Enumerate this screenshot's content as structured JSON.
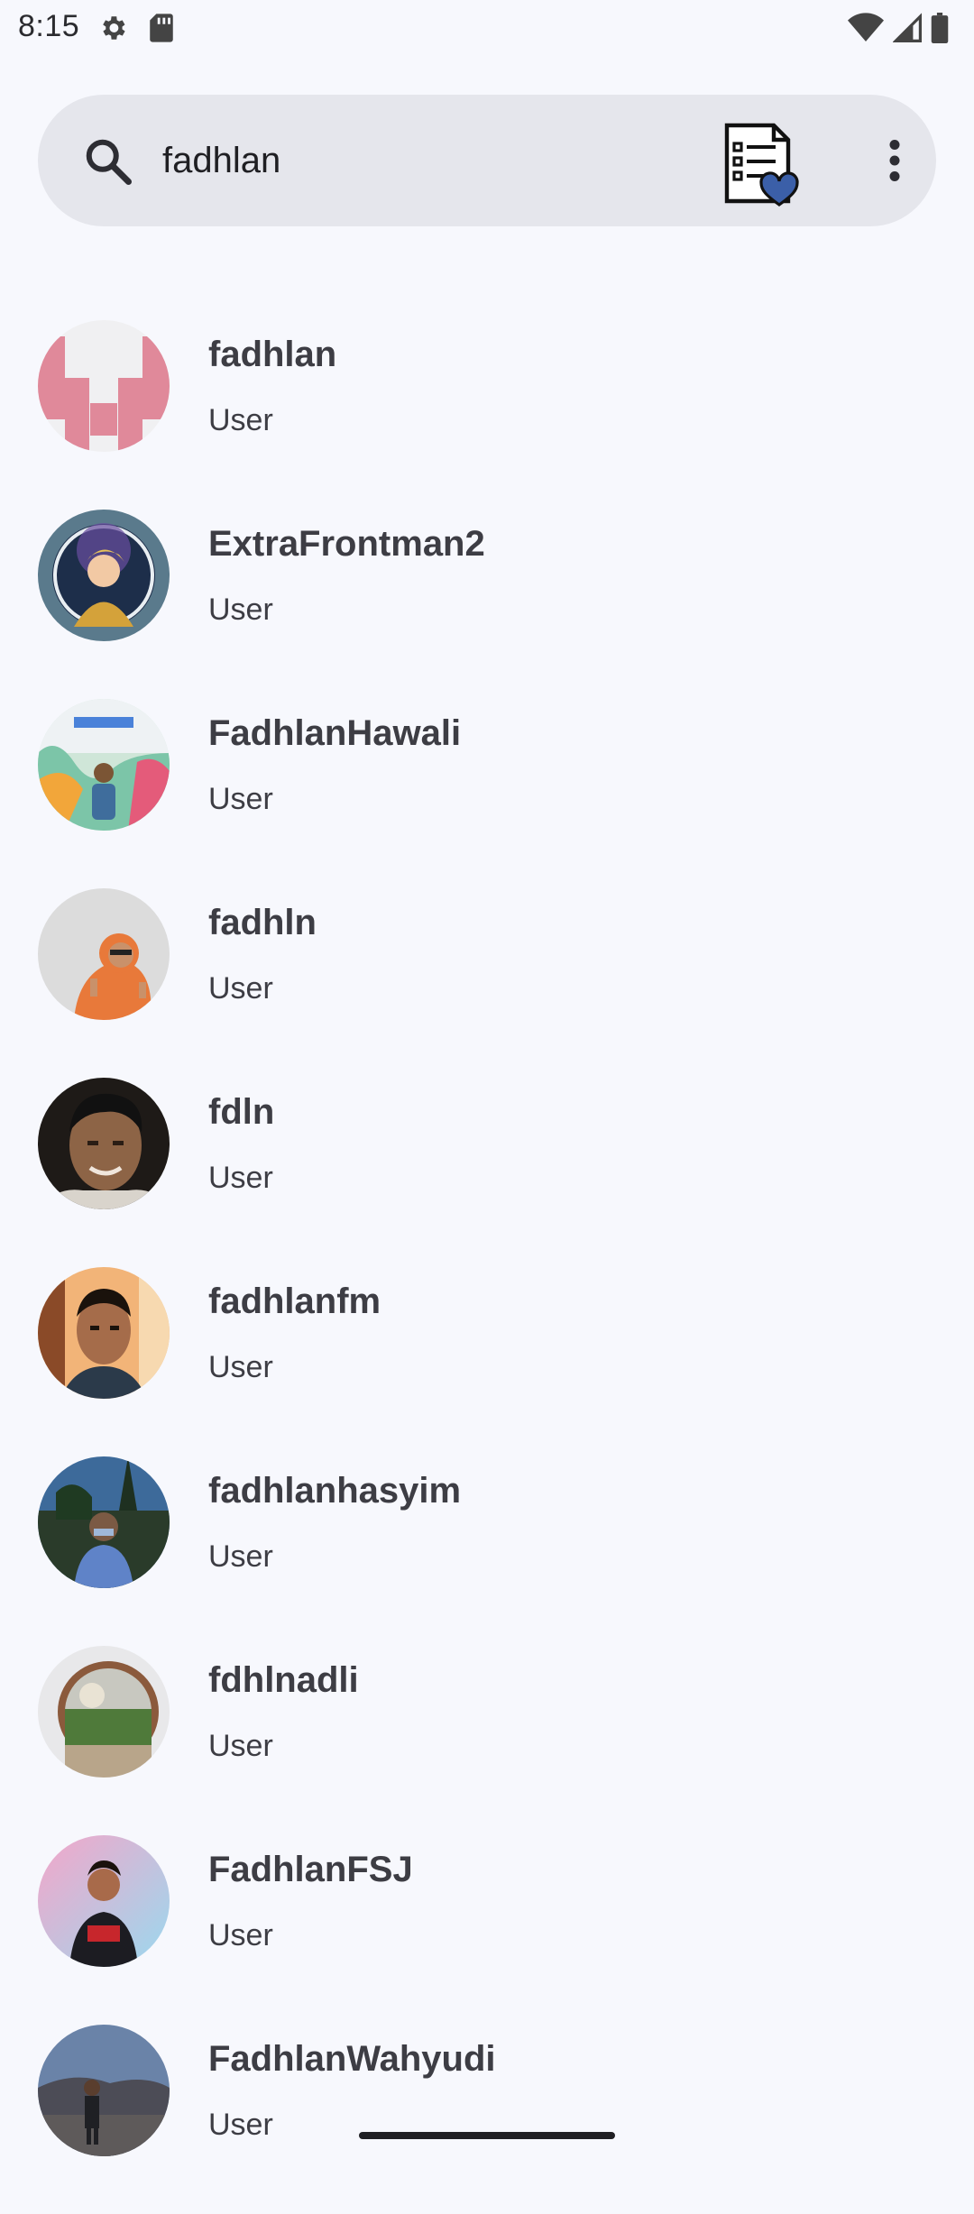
{
  "status_bar": {
    "time": "8:15",
    "left_icons": [
      "settings-icon",
      "sd-card-icon"
    ],
    "right_icons": [
      "wifi-icon",
      "cell-signal-icon",
      "battery-icon"
    ]
  },
  "search": {
    "value": "fadhlan",
    "placeholder": ""
  },
  "toolbar_icons": [
    "search-icon",
    "favorite-list-icon",
    "more-vert-icon"
  ],
  "results": [
    {
      "name": "fadhlan",
      "role": "User",
      "avatar": "identicon-pink"
    },
    {
      "name": "ExtraFrontman2",
      "role": "User",
      "avatar": "game-hero"
    },
    {
      "name": "FadhlanHawali",
      "role": "User",
      "avatar": "google-event"
    },
    {
      "name": "fadhln",
      "role": "User",
      "avatar": "orange-hoodie"
    },
    {
      "name": "fdln",
      "role": "User",
      "avatar": "dark-portrait"
    },
    {
      "name": "fadhlanfm",
      "role": "User",
      "avatar": "warm-portrait"
    },
    {
      "name": "fadhlanhasyim",
      "role": "User",
      "avatar": "outdoor-park"
    },
    {
      "name": "fdhlnadli",
      "role": "User",
      "avatar": "fisheye-mirror"
    },
    {
      "name": "FadhlanFSJ",
      "role": "User",
      "avatar": "pink-gradient"
    },
    {
      "name": "FadhlanWahyudi",
      "role": "User",
      "avatar": "volcano-landscape"
    }
  ],
  "colors": {
    "background": "#f7f8fd",
    "search_bar": "#e5e6ec",
    "text": "#3d3d44",
    "identicon": "#e0899a"
  }
}
